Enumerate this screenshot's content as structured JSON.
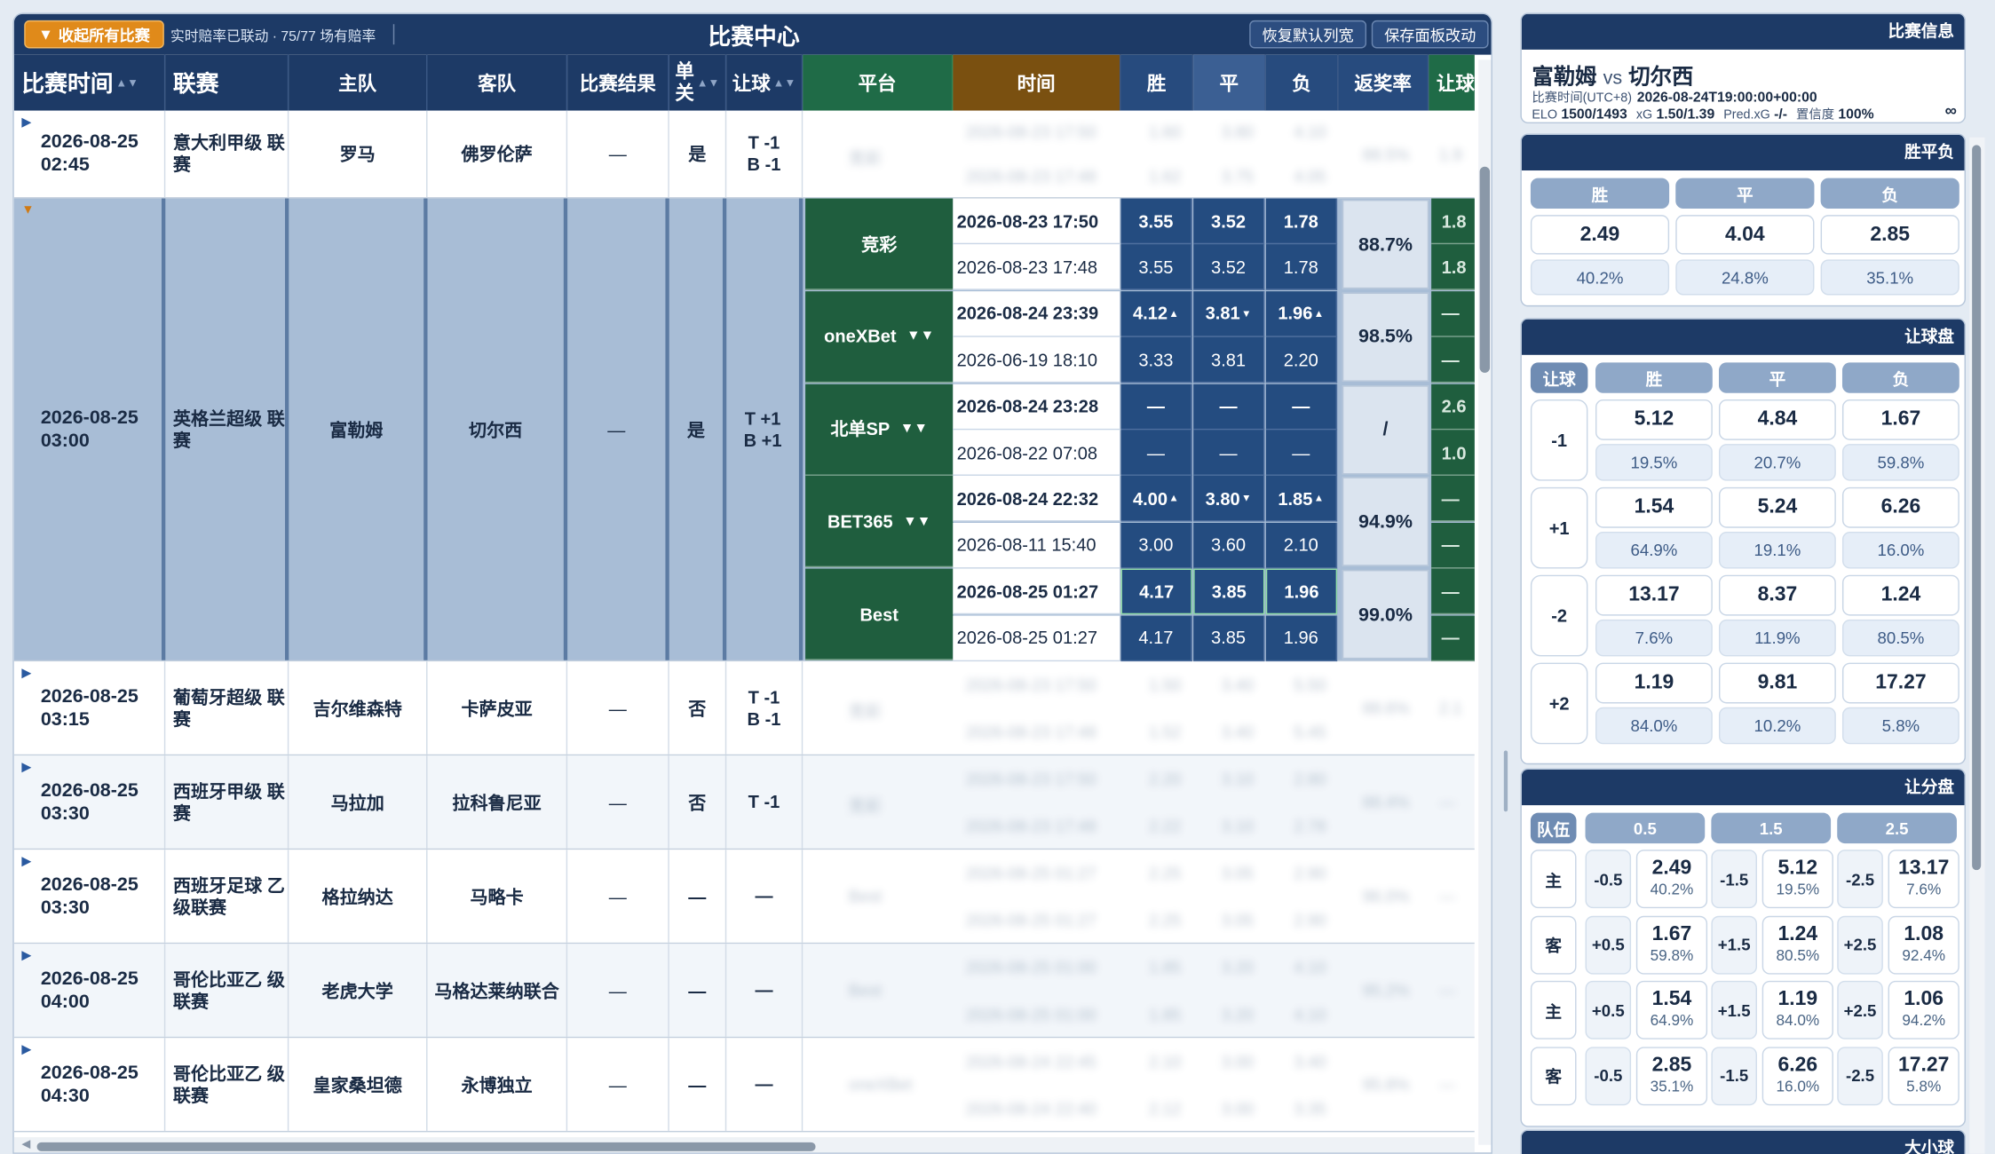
{
  "toolbar": {
    "collapse_label": "收起所有比赛",
    "sync_text": "实时赔率已联动 · 75/77 场有赔率",
    "title": "比赛中心",
    "reset_label": "恢复默认列宽",
    "save_label": "保存面板改动"
  },
  "columns": {
    "time": "比赛时间",
    "league": "联赛",
    "home": "主队",
    "away": "客队",
    "result": "比赛结果",
    "single": "单\n关",
    "handicap": "让球",
    "platform": "平台",
    "timestamp": "时间",
    "win": "胜",
    "draw": "平",
    "loss": "负",
    "return": "返奖率",
    "extra": "让球"
  },
  "sort_icon": "sort-icon",
  "rows": [
    {
      "time": "2026-08-25\n02:45",
      "league": "意大利甲级\n联赛",
      "home": "罗马",
      "away": "佛罗伦萨",
      "result": "—",
      "single": "是",
      "handicap": "T -1\nB -1"
    },
    {
      "time": "2026-08-25\n03:00",
      "league": "英格兰超级\n联赛",
      "home": "富勒姆",
      "away": "切尔西",
      "result": "—",
      "single": "是",
      "handicap": "T +1\nB +1"
    },
    {
      "time": "2026-08-25\n03:15",
      "league": "葡萄牙超级\n联赛",
      "home": "吉尔维森特",
      "away": "卡萨皮亚",
      "result": "—",
      "single": "否",
      "handicap": "T -1\nB -1"
    },
    {
      "time": "2026-08-25\n03:30",
      "league": "西班牙甲级\n联赛",
      "home": "马拉加",
      "away": "拉科鲁尼亚",
      "result": "—",
      "single": "否",
      "handicap": "T -1"
    },
    {
      "time": "2026-08-25\n03:30",
      "league": "西班牙足球\n乙级联赛",
      "home": "格拉纳达",
      "away": "马略卡",
      "result": "—",
      "single": "—",
      "handicap": "—"
    },
    {
      "time": "2026-08-25\n04:00",
      "league": "哥伦比亚乙\n级联赛",
      "home": "老虎大学",
      "away": "马格达莱纳联合",
      "result": "—",
      "single": "—",
      "handicap": "—"
    },
    {
      "time": "2026-08-25\n04:30",
      "league": "哥伦比亚乙\n级联赛",
      "home": "皇家桑坦德",
      "away": "永博独立",
      "result": "—",
      "single": "—",
      "handicap": "—"
    }
  ],
  "platforms": [
    {
      "name": "竞彩",
      "dropdown": false,
      "lines": [
        {
          "time": "2026-08-23 17:50",
          "bold": true,
          "w": "3.55",
          "d": "3.52",
          "l": "1.78",
          "wt": "",
          "dt": "",
          "lt": ""
        },
        {
          "time": "2026-08-23 17:48",
          "bold": false,
          "w": "3.55",
          "d": "3.52",
          "l": "1.78",
          "wt": "",
          "dt": "",
          "lt": ""
        }
      ],
      "return": "88.7%",
      "extra": [
        "1.8",
        "1.8"
      ]
    },
    {
      "name": "oneXBet",
      "dropdown": true,
      "lines": [
        {
          "time": "2026-08-24 23:39",
          "bold": true,
          "w": "4.12",
          "d": "3.81",
          "l": "1.96",
          "wt": "▲",
          "dt": "▼",
          "lt": "▲"
        },
        {
          "time": "2026-06-19 18:10",
          "bold": false,
          "w": "3.33",
          "d": "3.81",
          "l": "2.20",
          "wt": "",
          "dt": "",
          "lt": ""
        }
      ],
      "return": "98.5%",
      "extra": [
        "—",
        "—"
      ]
    },
    {
      "name": "北单SP",
      "dropdown": true,
      "lines": [
        {
          "time": "2026-08-24 23:28",
          "bold": true,
          "w": "—",
          "d": "—",
          "l": "—",
          "wt": "",
          "dt": "",
          "lt": ""
        },
        {
          "time": "2026-08-22 07:08",
          "bold": false,
          "w": "—",
          "d": "—",
          "l": "—",
          "wt": "",
          "dt": "",
          "lt": ""
        }
      ],
      "return": "/",
      "extra": [
        "2.6",
        "1.0"
      ]
    },
    {
      "name": "BET365",
      "dropdown": true,
      "lines": [
        {
          "time": "2026-08-24 22:32",
          "bold": true,
          "w": "4.00",
          "d": "3.80",
          "l": "1.85",
          "wt": "▲",
          "dt": "▼",
          "lt": "▲"
        },
        {
          "time": "2026-08-11 15:40",
          "bold": false,
          "w": "3.00",
          "d": "3.60",
          "l": "2.10",
          "wt": "",
          "dt": "",
          "lt": ""
        }
      ],
      "return": "94.9%",
      "extra": [
        "—",
        "—"
      ]
    },
    {
      "name": "Best",
      "dropdown": false,
      "lines": [
        {
          "time": "2026-08-25 01:27",
          "bold": true,
          "w": "4.17",
          "d": "3.85",
          "l": "1.96",
          "wt": "",
          "dt": "",
          "lt": ""
        },
        {
          "time": "2026-08-25 01:27",
          "bold": false,
          "w": "4.17",
          "d": "3.85",
          "l": "1.96",
          "wt": "",
          "dt": "",
          "lt": ""
        }
      ],
      "return": "99.0%",
      "extra": [
        "—",
        "—"
      ]
    }
  ],
  "blurred": [
    {
      "p": "竞彩",
      "t1": "2026-08-23 17:50",
      "t2": "2026-08-23 17:48",
      "o": [
        "1.60",
        "3.80",
        "4.10"
      ],
      "o2": [
        "1.62",
        "3.75",
        "4.05"
      ],
      "r": "88.5%",
      "e": "1.9"
    },
    {
      "p": "竞彩",
      "t1": "2026-08-23 17:50",
      "t2": "2026-08-23 17:48",
      "o": [
        "1.50",
        "3.40",
        "5.50"
      ],
      "o2": [
        "1.52",
        "3.40",
        "5.45"
      ],
      "r": "88.6%",
      "e": "2.1"
    },
    {
      "p": "竞彩",
      "t1": "2026-08-23 17:50",
      "t2": "2026-08-23 17:48",
      "o": [
        "2.20",
        "3.10",
        "2.80"
      ],
      "o2": [
        "2.22",
        "3.10",
        "2.78"
      ],
      "r": "88.4%",
      "e": "—"
    },
    {
      "p": "Best",
      "t1": "2026-08-25 01:27",
      "t2": "2026-08-25 01:27",
      "o": [
        "2.25",
        "3.05",
        "2.90"
      ],
      "o2": [
        "2.25",
        "3.05",
        "2.90"
      ],
      "r": "96.0%",
      "e": "—"
    },
    {
      "p": "Best",
      "t1": "2026-08-25 01:00",
      "t2": "2026-08-25 01:00",
      "o": [
        "1.85",
        "3.20",
        "4.10"
      ],
      "o2": [
        "1.85",
        "3.20",
        "4.10"
      ],
      "r": "95.2%",
      "e": "—"
    },
    {
      "p": "oneXBet",
      "t1": "2026-08-24 22:45",
      "t2": "2026-08-24 22:40",
      "o": [
        "2.10",
        "3.00",
        "3.40"
      ],
      "o2": [
        "2.12",
        "3.00",
        "3.35"
      ],
      "r": "95.8%",
      "e": "—"
    }
  ],
  "match": {
    "header": "比赛信息",
    "home": "富勒姆",
    "vs": "vs",
    "away": "切尔西",
    "time_label": "比赛时间(UTC+8)",
    "time_value": "2026-08-24T19:00:00+00:00",
    "elo_label": "ELO",
    "elo_value": "1500/1493",
    "xg_label": "xG",
    "xg_value": "1.50/1.39",
    "pxg_label": "Pred.xG",
    "pxg_value": "-/-",
    "conf_label": "置信度",
    "conf_value": "100%",
    "infinity": "∞"
  },
  "wdl": {
    "header": "胜平负",
    "labels": [
      "胜",
      "平",
      "负"
    ],
    "odds": [
      "2.49",
      "4.04",
      "2.85"
    ],
    "probs": [
      "40.2%",
      "24.8%",
      "35.1%"
    ]
  },
  "handicap": {
    "header": "让球盘",
    "col_label": "让球",
    "labels": [
      "胜",
      "平",
      "负"
    ],
    "rows": [
      {
        "line": "-1",
        "odds": [
          "5.12",
          "4.84",
          "1.67"
        ],
        "probs": [
          "19.5%",
          "20.7%",
          "59.8%"
        ]
      },
      {
        "line": "+1",
        "odds": [
          "1.54",
          "5.24",
          "6.26"
        ],
        "probs": [
          "64.9%",
          "19.1%",
          "16.0%"
        ]
      },
      {
        "line": "-2",
        "odds": [
          "13.17",
          "8.37",
          "1.24"
        ],
        "probs": [
          "7.6%",
          "11.9%",
          "80.5%"
        ]
      },
      {
        "line": "+2",
        "odds": [
          "1.19",
          "9.81",
          "17.27"
        ],
        "probs": [
          "84.0%",
          "10.2%",
          "5.8%"
        ]
      }
    ]
  },
  "spread": {
    "header": "让分盘",
    "team_label": "队伍",
    "cols": [
      "0.5",
      "1.5",
      "2.5"
    ],
    "rows": [
      {
        "team": "主",
        "cells": [
          {
            "line": "-0.5",
            "odd": "2.49",
            "pct": "40.2%"
          },
          {
            "line": "-1.5",
            "odd": "5.12",
            "pct": "19.5%"
          },
          {
            "line": "-2.5",
            "odd": "13.17",
            "pct": "7.6%"
          }
        ]
      },
      {
        "team": "客",
        "cells": [
          {
            "line": "+0.5",
            "odd": "1.67",
            "pct": "59.8%"
          },
          {
            "line": "+1.5",
            "odd": "1.24",
            "pct": "80.5%"
          },
          {
            "line": "+2.5",
            "odd": "1.08",
            "pct": "92.4%"
          }
        ]
      },
      {
        "team": "主",
        "cells": [
          {
            "line": "+0.5",
            "odd": "1.54",
            "pct": "64.9%"
          },
          {
            "line": "+1.5",
            "odd": "1.19",
            "pct": "84.0%"
          },
          {
            "line": "+2.5",
            "odd": "1.06",
            "pct": "94.2%"
          }
        ]
      },
      {
        "team": "客",
        "cells": [
          {
            "line": "-0.5",
            "odd": "2.85",
            "pct": "35.1%"
          },
          {
            "line": "-1.5",
            "odd": "6.26",
            "pct": "16.0%"
          },
          {
            "line": "-2.5",
            "odd": "17.27",
            "pct": "5.8%"
          }
        ]
      }
    ]
  },
  "totals": {
    "header": "大小球"
  }
}
